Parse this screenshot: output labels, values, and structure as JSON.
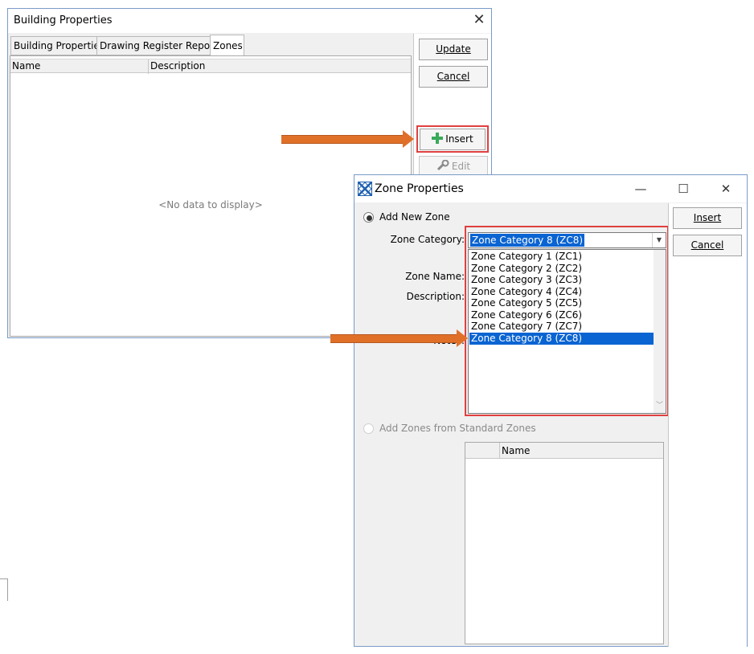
{
  "building_properties": {
    "title": "Building Properties",
    "close_glyph": "✕",
    "tabs": [
      {
        "label": "Building Properties",
        "active": false
      },
      {
        "label": "Drawing Register Report",
        "active": false
      },
      {
        "label": "Zones",
        "active": true
      }
    ],
    "grid": {
      "columns": [
        "Name",
        "Description"
      ],
      "empty_text": "<No data to display>"
    },
    "buttons": {
      "update": "Update",
      "cancel": "Cancel",
      "insert": "Insert",
      "edit": "Edit"
    }
  },
  "zone_properties": {
    "title": "Zone Properties",
    "window_controls": {
      "minimize": "—",
      "maximize": "☐",
      "close": "✕"
    },
    "add_new_zone": {
      "label": "Add New Zone",
      "checked": true
    },
    "zone_category_label": "Zone Category:",
    "zone_category_value": "Zone Category 8 (ZC8)",
    "zone_name_label": "Zone Name:",
    "description_label": "Description:",
    "notes_label": "Notes:",
    "dropdown_options": [
      "Zone Category 1 (ZC1)",
      "Zone Category 2 (ZC2)",
      "Zone Category 3 (ZC3)",
      "Zone Category 4 (ZC4)",
      "Zone Category 5 (ZC5)",
      "Zone Category 6 (ZC6)",
      "Zone Category 7 (ZC7)",
      "Zone Category 8 (ZC8)"
    ],
    "selected_option_index": 7,
    "add_from_standard": {
      "label": "Add Zones from Standard Zones",
      "checked": false,
      "enabled": false
    },
    "standard_grid_columns": [
      "",
      "Name"
    ],
    "buttons": {
      "insert": "Insert",
      "cancel": "Cancel"
    }
  },
  "colors": {
    "highlight_box": "#e04040",
    "annotation_arrow": "#e07028",
    "selection": "#0a64d2",
    "insert_plus": "#3aaa5a"
  }
}
